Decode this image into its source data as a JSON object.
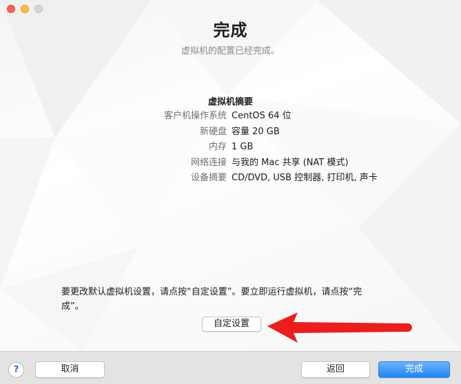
{
  "window": {
    "title": "完成",
    "subtitle": "虚拟机的配置已经完成。"
  },
  "summary": {
    "heading": "虚拟机摘要",
    "rows": [
      {
        "label": "客户机操作系统",
        "value": "CentOS 64 位"
      },
      {
        "label": "新硬盘",
        "value": "容量 20 GB"
      },
      {
        "label": "内存",
        "value": "1 GB"
      },
      {
        "label": "网络连接",
        "value": "与我的 Mac 共享 (NAT 模式)"
      },
      {
        "label": "设备摘要",
        "value": "CD/DVD, USB 控制器, 打印机, 声卡"
      }
    ]
  },
  "note": {
    "line1": "要更改默认虚拟机设置，请点按“自定设置”。要立即运行虚拟机，请点按“完",
    "line2": "成”。"
  },
  "customize_label": "自定设置",
  "footer": {
    "help_label": "?",
    "cancel_label": "取消",
    "back_label": "返回",
    "done_label": "完成"
  },
  "colors": {
    "accent": "#1f87f5",
    "arrow": "#ee1c1c",
    "traffic_close": "#fc605c",
    "traffic_min": "#fdbc40"
  },
  "icons": [
    "close-light",
    "minimize-light",
    "maximize-light",
    "help-icon",
    "red-arrow-annotation"
  ]
}
